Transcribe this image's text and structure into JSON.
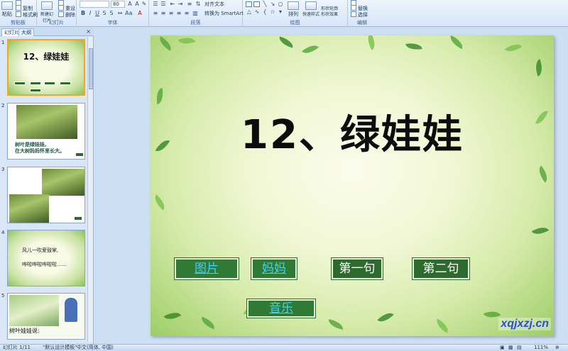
{
  "ribbon": {
    "clipboard": {
      "label": "剪贴板",
      "paste": "粘贴",
      "copy": "复制",
      "format_painter": "格式刷"
    },
    "slides": {
      "label": "幻灯片",
      "new_slide": "新建幻灯片",
      "reset": "重设",
      "delete": "删除"
    },
    "font": {
      "label": "字体",
      "size": "80"
    },
    "paragraph": {
      "label": "段落",
      "align_text": "对齐文本",
      "convert_smartart": "转换为 SmartArt"
    },
    "drawing": {
      "label": "绘图",
      "arrange": "排列",
      "quick_styles": "快速样式",
      "shape_fill": "形状轮廓",
      "shape_effects": "形状效果"
    },
    "editing": {
      "label": "编辑",
      "replace": "替换",
      "select": "选择"
    }
  },
  "panel": {
    "tabs": [
      "幻灯片",
      "大纲"
    ],
    "close": "×",
    "thumbnails": [
      {
        "num": "1",
        "title": "12、绿娃娃"
      },
      {
        "num": "2",
        "text_line1": "树叶是绿娃娃,",
        "text_line2": "在大树妈妈怀里长大。"
      },
      {
        "num": "3"
      },
      {
        "num": "4",
        "text_line1": "风儿一吹爱鼓掌,",
        "text_line2": "哗啦哗啦哗啦啦……"
      },
      {
        "num": "5",
        "text_line1": "树叶娃娃说:"
      }
    ]
  },
  "slide": {
    "title": "12、绿娃娃",
    "buttons": {
      "pictures": "图片",
      "mom": "妈妈",
      "sentence1": "第一句",
      "sentence2": "第二句",
      "music": "音乐"
    },
    "watermark": "xqjxzj.cn"
  },
  "status": {
    "slide_pos": "幻灯片 1/11",
    "theme": "\"默认设计模板\"",
    "lang": "中文(简体, 中国)",
    "zoom": "111%"
  }
}
